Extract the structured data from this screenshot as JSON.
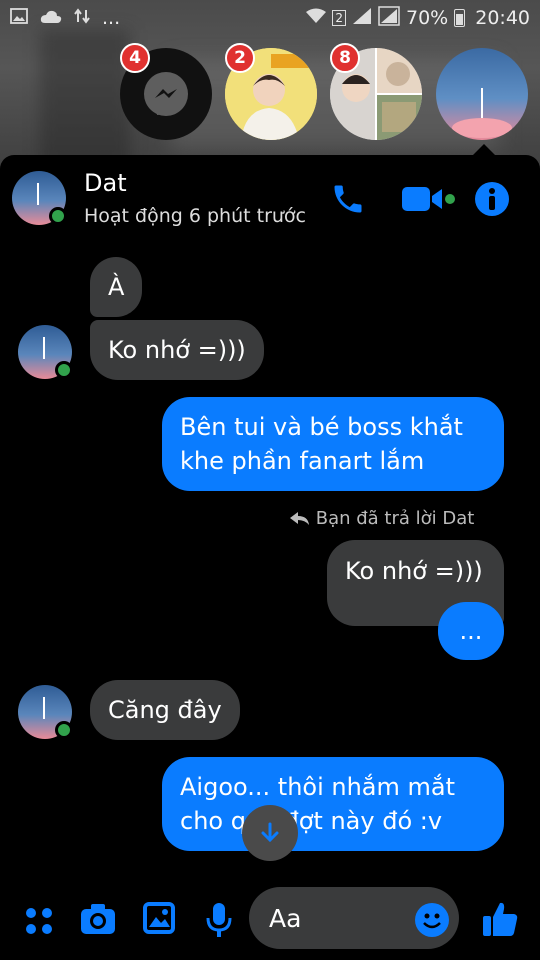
{
  "status_bar": {
    "battery": "70%",
    "time": "20:40",
    "sim_label": "2",
    "more": "..."
  },
  "chat_heads": [
    {
      "badge": "4",
      "kind": "messenger-icon"
    },
    {
      "badge": "2",
      "kind": "contact-photo"
    },
    {
      "badge": "8",
      "kind": "contact-photo"
    },
    {
      "badge": "",
      "kind": "contact-photo-active"
    }
  ],
  "header": {
    "name": "Dat",
    "status": "Hoạt động 6 phút trước"
  },
  "messages": [
    {
      "dir": "in",
      "text": "À"
    },
    {
      "dir": "in",
      "text": "Ko nhớ =)))"
    },
    {
      "dir": "out",
      "line1": "Bên tui và bé boss khắt",
      "line2": "khe phần fanart lắm"
    },
    {
      "dir": "out",
      "text": "Ko nhớ =)))"
    },
    {
      "dir": "out",
      "text": "..."
    },
    {
      "dir": "in",
      "text": "Căng đây"
    },
    {
      "dir": "out",
      "line1": "Aigoo... thôi nhắm mắt",
      "line2": "cho qua đợt này đó :v"
    }
  ],
  "reply_note": "Bạn đã trả lời Dat",
  "composer": {
    "placeholder": "Aa"
  },
  "colors": {
    "accent": "#0a7cff",
    "incoming_bubble": "#3a3b3c",
    "online": "#31a24c",
    "badge": "#e0312f"
  }
}
